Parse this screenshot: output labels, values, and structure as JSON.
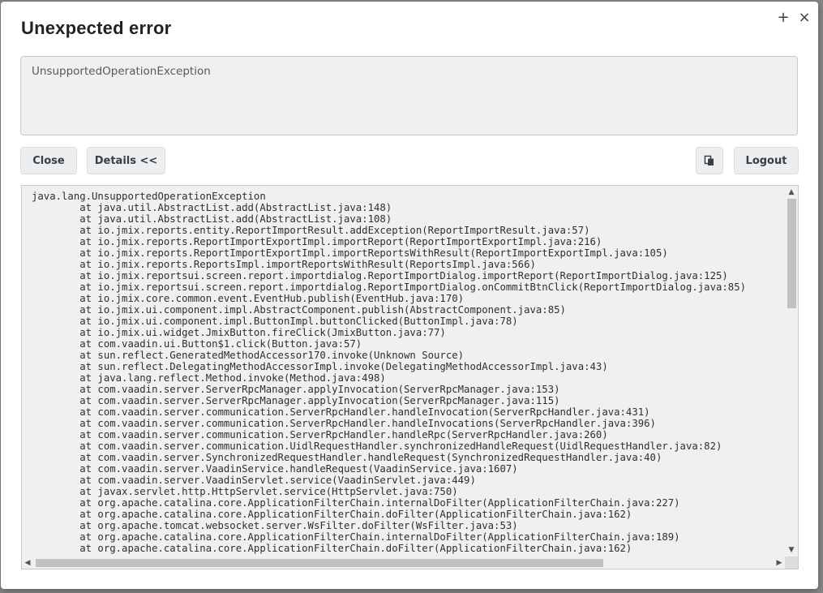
{
  "dialog": {
    "title": "Unexpected error",
    "maximize_glyph": "+",
    "close_glyph": "×"
  },
  "message": {
    "text": "UnsupportedOperationException"
  },
  "buttons": {
    "close_label": "Close",
    "details_label": "Details <<",
    "copy_icon": "copy-icon",
    "logout_label": "Logout"
  },
  "stacktrace": {
    "lines": [
      "java.lang.UnsupportedOperationException",
      "\tat java.util.AbstractList.add(AbstractList.java:148)",
      "\tat java.util.AbstractList.add(AbstractList.java:108)",
      "\tat io.jmix.reports.entity.ReportImportResult.addException(ReportImportResult.java:57)",
      "\tat io.jmix.reports.ReportImportExportImpl.importReport(ReportImportExportImpl.java:216)",
      "\tat io.jmix.reports.ReportImportExportImpl.importReportsWithResult(ReportImportExportImpl.java:105)",
      "\tat io.jmix.reports.ReportsImpl.importReportsWithResult(ReportsImpl.java:566)",
      "\tat io.jmix.reportsui.screen.report.importdialog.ReportImportDialog.importReport(ReportImportDialog.java:125)",
      "\tat io.jmix.reportsui.screen.report.importdialog.ReportImportDialog.onCommitBtnClick(ReportImportDialog.java:85)",
      "\tat io.jmix.core.common.event.EventHub.publish(EventHub.java:170)",
      "\tat io.jmix.ui.component.impl.AbstractComponent.publish(AbstractComponent.java:85)",
      "\tat io.jmix.ui.component.impl.ButtonImpl.buttonClicked(ButtonImpl.java:78)",
      "\tat io.jmix.ui.widget.JmixButton.fireClick(JmixButton.java:77)",
      "\tat com.vaadin.ui.Button$1.click(Button.java:57)",
      "\tat sun.reflect.GeneratedMethodAccessor170.invoke(Unknown Source)",
      "\tat sun.reflect.DelegatingMethodAccessorImpl.invoke(DelegatingMethodAccessorImpl.java:43)",
      "\tat java.lang.reflect.Method.invoke(Method.java:498)",
      "\tat com.vaadin.server.ServerRpcManager.applyInvocation(ServerRpcManager.java:153)",
      "\tat com.vaadin.server.ServerRpcManager.applyInvocation(ServerRpcManager.java:115)",
      "\tat com.vaadin.server.communication.ServerRpcHandler.handleInvocation(ServerRpcHandler.java:431)",
      "\tat com.vaadin.server.communication.ServerRpcHandler.handleInvocations(ServerRpcHandler.java:396)",
      "\tat com.vaadin.server.communication.ServerRpcHandler.handleRpc(ServerRpcHandler.java:260)",
      "\tat com.vaadin.server.communication.UidlRequestHandler.synchronizedHandleRequest(UidlRequestHandler.java:82)",
      "\tat com.vaadin.server.SynchronizedRequestHandler.handleRequest(SynchronizedRequestHandler.java:40)",
      "\tat com.vaadin.server.VaadinService.handleRequest(VaadinService.java:1607)",
      "\tat com.vaadin.server.VaadinServlet.service(VaadinServlet.java:449)",
      "\tat javax.servlet.http.HttpServlet.service(HttpServlet.java:750)",
      "\tat org.apache.catalina.core.ApplicationFilterChain.internalDoFilter(ApplicationFilterChain.java:227)",
      "\tat org.apache.catalina.core.ApplicationFilterChain.doFilter(ApplicationFilterChain.java:162)",
      "\tat org.apache.tomcat.websocket.server.WsFilter.doFilter(WsFilter.java:53)",
      "\tat org.apache.catalina.core.ApplicationFilterChain.internalDoFilter(ApplicationFilterChain.java:189)",
      "\tat org.apache.catalina.core.ApplicationFilterChain.doFilter(ApplicationFilterChain.java:162)"
    ],
    "scroll_up_glyph": "▲",
    "scroll_down_glyph": "▼",
    "scroll_left_glyph": "◀",
    "scroll_right_glyph": "▶"
  }
}
